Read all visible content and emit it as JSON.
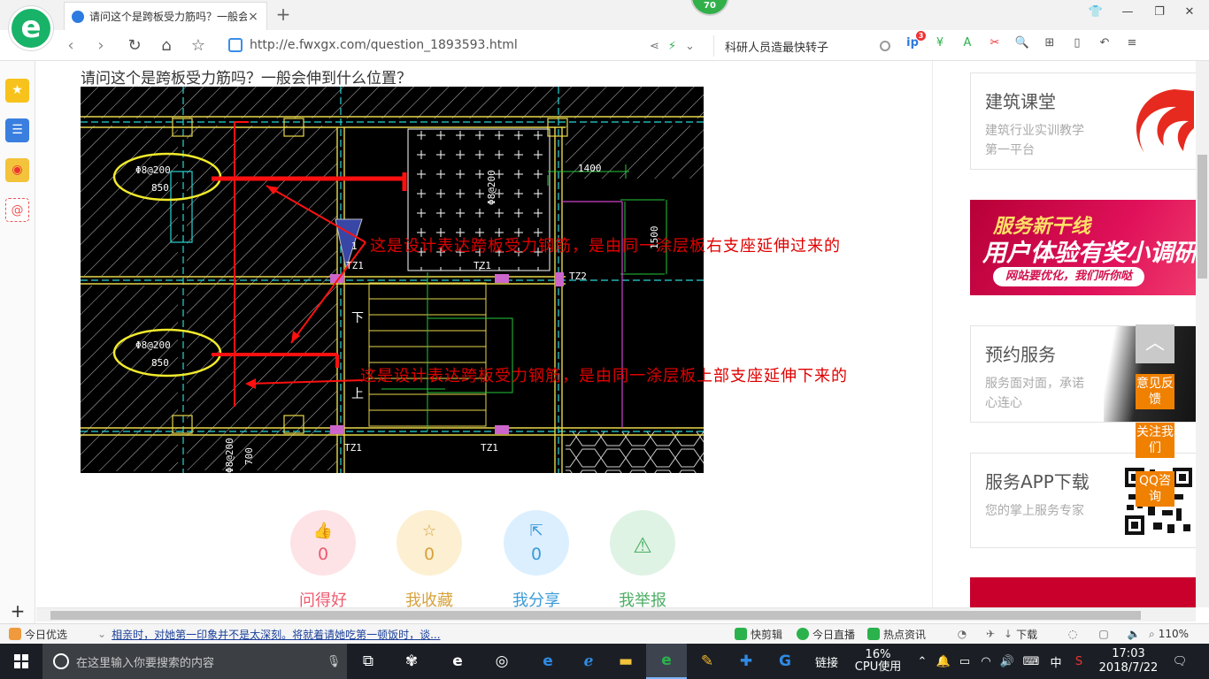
{
  "browser": {
    "tab_title": "请问这个是跨板受力筋吗？一般会",
    "tab_close": "×",
    "new_tab": "+",
    "badge": "70",
    "url": "http://e.fwxgx.com/question_1893593.html",
    "search_query": "科研人员造最快转子",
    "ext_badge": "3"
  },
  "page": {
    "question": "请问这个是跨板受力筋吗？一般会伸到什么位置？",
    "annotation_1": "这是设计表达跨板受力钢筋，是由同一涂层板右支座延伸过来的",
    "annotation_2": "这是设计表达跨板受力钢筋，是由同一涂层板上部支座延伸下来的",
    "cad": {
      "rebar_top": "Φ8@200",
      "len_top": "850",
      "rebar_mid": "Φ8@200",
      "len_mid": "850",
      "dim_1400": "1400",
      "dim_1500": "1500",
      "rebar_right": "Φ8@200",
      "rebar_bottom": "Φ8@200",
      "len_bottom": "700",
      "tz1_a": "TZ1",
      "tz1_b": "TZ1",
      "tz2": "TZ2",
      "tz1_c": "TZ1",
      "tz1_d": "TZ1",
      "stair_down": "下",
      "stair_up": "上",
      "note_1": "1"
    },
    "actions": [
      {
        "label": "问得好",
        "count": "0",
        "color": "#ee5a6f",
        "bg": "#fde3e6"
      },
      {
        "label": "我收藏",
        "count": "0",
        "color": "#d7a23c",
        "bg": "#fdefd2"
      },
      {
        "label": "我分享",
        "count": "0",
        "color": "#3a9ad9",
        "bg": "#dcefff"
      },
      {
        "label": "我举报",
        "count": "0",
        "color": "#4cae63",
        "bg": "#dff3e4"
      }
    ],
    "sidebar_cards": [
      {
        "title": "建筑课堂",
        "sub": "建筑行业实训教学第一平台"
      },
      {
        "title": "预约服务",
        "sub": "服务面对面，承诺心连心"
      },
      {
        "title": "服务APP下载",
        "sub": "您的掌上服务专家"
      }
    ],
    "banner": {
      "line1": "服务新干线",
      "line2": "用户体验有奖小调研",
      "line3": "网站要优化，我们听你哒"
    },
    "floats": {
      "feedback": "意见反馈",
      "follow": "关注我们",
      "qq": "QQ咨询"
    }
  },
  "statusbar": {
    "today": "今日优选",
    "news": "相亲时，对她第一印象并不是太深刻。将就着请她吃第一顿饭时，谈...",
    "clip": "快剪辑",
    "live": "今日直播",
    "hot": "热点资讯",
    "download": "下载",
    "zoom": "110%"
  },
  "taskbar": {
    "search_placeholder": "在这里输入你要搜索的内容",
    "links": "链接",
    "cpu_pct": "16%",
    "cpu_label": "CPU使用",
    "ime": "中",
    "time": "17:03",
    "date": "2018/7/22"
  }
}
